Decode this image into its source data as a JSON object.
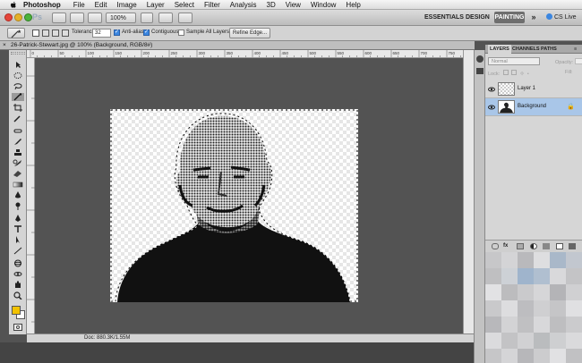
{
  "menubar": {
    "app_name": "Photoshop",
    "items": [
      "File",
      "Edit",
      "Image",
      "Layer",
      "Select",
      "Filter",
      "Analysis",
      "3D",
      "View",
      "Window",
      "Help"
    ]
  },
  "appbar": {
    "logo": "Ps",
    "zoom": "100%",
    "workspaces": [
      "ESSENTIALS",
      "DESIGN",
      "PAINTING"
    ],
    "more": "»",
    "cs_live": "CS Live"
  },
  "options": {
    "tolerance_label": "Tolerance:",
    "tolerance_value": "32",
    "anti_alias_label": "Anti-alias",
    "anti_alias_checked": true,
    "contiguous_label": "Contiguous",
    "contiguous_checked": true,
    "sample_all_label": "Sample All Layers",
    "sample_all_checked": false,
    "refine_edge_label": "Refine Edge..."
  },
  "document": {
    "tab_title": "26-Patrick-Stewart.jpg @ 100% (Background, RGB/8#)",
    "status_text": "Doc: 880.3K/1.55M"
  },
  "rulers": {
    "top_ticks": [
      "0",
      "50",
      "100",
      "150",
      "200",
      "250",
      "300",
      "350",
      "400",
      "450",
      "500",
      "550",
      "600",
      "650",
      "700",
      "750"
    ]
  },
  "layers_panel": {
    "tabs": [
      "LAYERS",
      "CHANNELS",
      "PATHS"
    ],
    "blend_mode": "Normal",
    "opacity_label": "Opacity:",
    "lock_label": "Lock:",
    "fill_label": "Fill:",
    "layers": [
      {
        "name": "Layer 1",
        "selected": false
      },
      {
        "name": "Background",
        "selected": true
      }
    ]
  },
  "colors": {
    "accent_blue": "#3b86e0",
    "selected_layer": "#a9c6e8",
    "foreground_swatch": "#f2c200",
    "background_swatch": "#ffffff",
    "workspace_bg": "#535353"
  },
  "icons": [
    "apple-icon",
    "move-tool-icon",
    "marquee-tool-icon",
    "lasso-tool-icon",
    "magic-wand-tool-icon",
    "crop-tool-icon",
    "eyedropper-tool-icon",
    "healing-brush-icon",
    "brush-tool-icon",
    "clone-stamp-icon",
    "history-brush-icon",
    "eraser-tool-icon",
    "gradient-tool-icon",
    "blur-tool-icon",
    "dodge-tool-icon",
    "pen-tool-icon",
    "type-tool-icon",
    "path-selection-icon",
    "shape-tool-icon",
    "3d-rotate-icon",
    "hand-tool-icon",
    "zoom-tool-icon",
    "eye-icon",
    "lock-icon",
    "link-icon",
    "fx-icon",
    "mask-icon",
    "new-layer-icon",
    "trash-icon"
  ]
}
